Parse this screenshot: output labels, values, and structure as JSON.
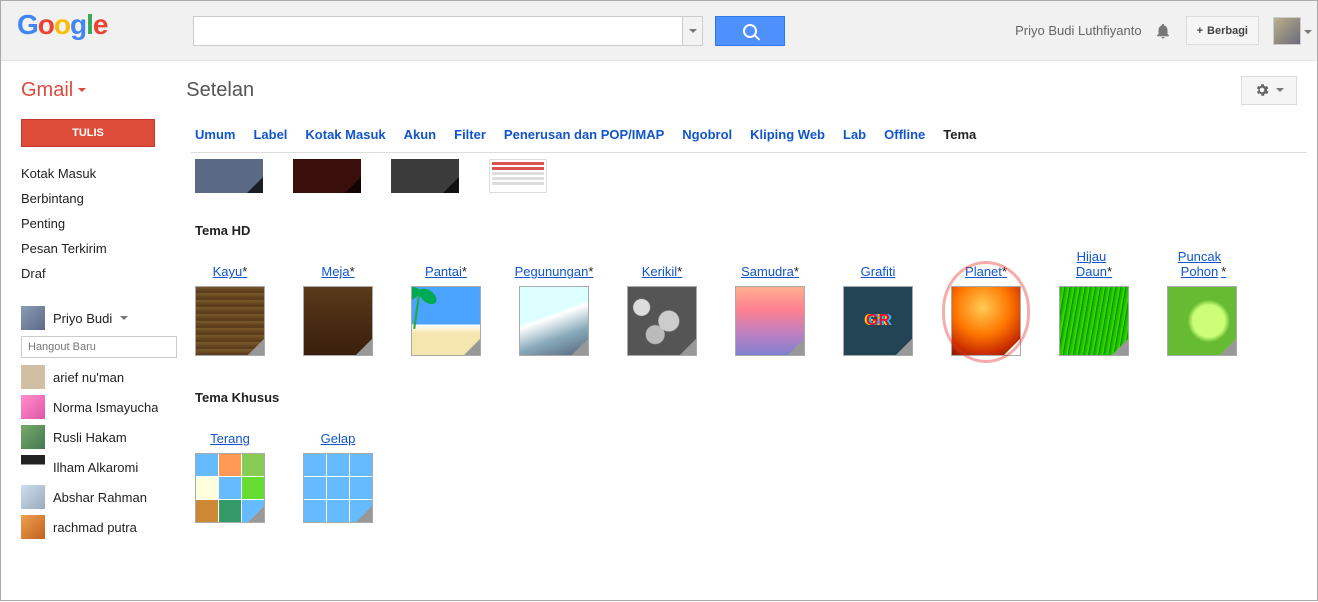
{
  "header": {
    "user_name": "Priyo Budi Luthfiyanto",
    "share": "Berbagi"
  },
  "app": {
    "gmail": "Gmail",
    "page_title": "Setelan"
  },
  "sidebar": {
    "compose": "TULIS",
    "labels": [
      "Kotak Masuk",
      "Berbintang",
      "Penting",
      "Pesan Terkirim",
      "Draf"
    ],
    "hangout_user": "Priyo Budi",
    "hangout_placeholder": "Hangout Baru",
    "contacts": [
      "arief nu'man",
      "Norma Ismayucha",
      "Rusli Hakam",
      "Ilham Alkaromi",
      "Abshar Rahman",
      "rachmad putra"
    ]
  },
  "tabs": [
    "Umum",
    "Label",
    "Kotak Masuk",
    "Akun",
    "Filter",
    "Penerusan dan POP/IMAP",
    "Ngobrol",
    "Kliping Web",
    "Lab",
    "Offline",
    "Tema"
  ],
  "active_tab": "Tema",
  "sections": {
    "hd_title": "Tema HD",
    "hd": [
      {
        "name": "Kayu",
        "star": true,
        "cls": "th-kayu"
      },
      {
        "name": "Meja",
        "star": true,
        "cls": "th-meja"
      },
      {
        "name": "Pantai",
        "star": true,
        "cls": "th-pantai"
      },
      {
        "name": "Pegunungan",
        "star": true,
        "cls": "th-gunung"
      },
      {
        "name": "Kerikil",
        "star": true,
        "cls": "th-kerikil"
      },
      {
        "name": "Samudra",
        "star": true,
        "cls": "th-samudra"
      },
      {
        "name": "Grafiti",
        "star": false,
        "cls": "th-grafiti"
      },
      {
        "name": "Planet",
        "star": true,
        "cls": "th-planet",
        "highlight": true
      },
      {
        "name": "Hijau\nDaun",
        "star": true,
        "cls": "th-daun"
      },
      {
        "name": "Puncak\nPohon",
        "star": true,
        "cls": "th-pohon"
      }
    ],
    "custom_title": "Tema Khusus",
    "custom": [
      {
        "name": "Terang",
        "cls": "th-terang"
      },
      {
        "name": "Gelap",
        "cls": "th-gelap"
      }
    ]
  }
}
